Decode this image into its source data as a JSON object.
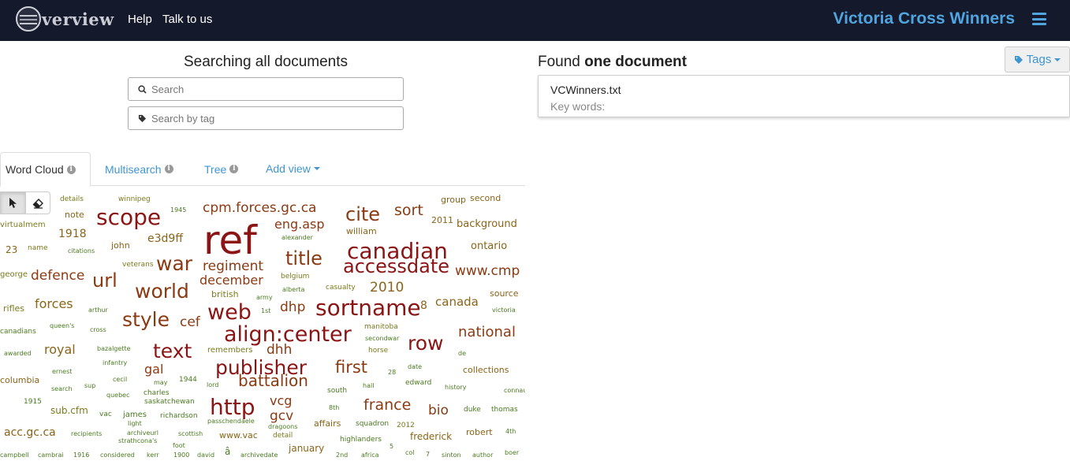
{
  "header": {
    "logo_text": "verview",
    "nav": [
      "Help",
      "Talk to us"
    ],
    "project_title": "Victoria Cross Winners",
    "colors": {
      "background": "#14192b",
      "accent": "#4fa5df"
    }
  },
  "search": {
    "title": "Searching all documents",
    "search_placeholder": "Search",
    "tag_placeholder": "Search by tag"
  },
  "tabs": [
    {
      "label": "Word Cloud",
      "active": true
    },
    {
      "label": "Multisearch",
      "active": false
    },
    {
      "label": "Tree",
      "active": false
    },
    {
      "label": "Add view",
      "active": false
    }
  ],
  "toolbar": {
    "icons": [
      "pointer-icon",
      "eraser-icon"
    ]
  },
  "word_cloud": [
    {
      "t": "ref",
      "s": 3,
      "c": "c0"
    },
    {
      "t": "scope",
      "s": 2,
      "c": "c0"
    },
    {
      "t": "canadian",
      "s": 2,
      "c": "c0"
    },
    {
      "t": "align:center",
      "s": 2,
      "c": "c0"
    },
    {
      "t": "accessdate",
      "s": 2,
      "c": "c0"
    },
    {
      "t": "sortname",
      "s": 2,
      "c": "c0"
    },
    {
      "t": "publisher",
      "s": 2,
      "c": "c0"
    },
    {
      "t": "web",
      "s": 2,
      "c": "c0"
    },
    {
      "t": "http",
      "s": 2,
      "c": "c0"
    },
    {
      "t": "text",
      "s": 2,
      "c": "c0"
    },
    {
      "t": "world",
      "s": 2,
      "c": "c1"
    },
    {
      "t": "style",
      "s": 2,
      "c": "c1"
    },
    {
      "t": "war",
      "s": 2,
      "c": "c1"
    },
    {
      "t": "title",
      "s": 2,
      "c": "c1"
    },
    {
      "t": "row",
      "s": 2,
      "c": "c0"
    },
    {
      "t": "cite",
      "s": 2,
      "c": "c1"
    },
    {
      "t": "url",
      "s": 2,
      "c": "c1"
    },
    {
      "t": "battalion",
      "s": 2,
      "c": "c1"
    },
    {
      "t": "first",
      "s": 2,
      "c": "c1"
    },
    {
      "t": "france",
      "s": 1,
      "c": "c1"
    },
    {
      "t": "national",
      "s": 1,
      "c": "c1"
    },
    {
      "t": "www.cmp",
      "s": 1,
      "c": "c1"
    },
    {
      "t": "sort",
      "s": 1,
      "c": "c1"
    },
    {
      "t": "cpm.forces.gc.ca",
      "s": 1,
      "c": "c1"
    },
    {
      "t": "eng.asp",
      "s": 1,
      "c": "c1"
    },
    {
      "t": "regiment",
      "s": 1,
      "c": "c1"
    },
    {
      "t": "december",
      "s": 1,
      "c": "c1"
    },
    {
      "t": "defence",
      "s": 1,
      "c": "c1"
    },
    {
      "t": "forces",
      "s": 1,
      "c": "c2"
    },
    {
      "t": "royal",
      "s": 1,
      "c": "c2"
    },
    {
      "t": "gal",
      "s": 1,
      "c": "c1"
    },
    {
      "t": "cef",
      "s": 1,
      "c": "c1"
    },
    {
      "t": "dhp",
      "s": 1,
      "c": "c1"
    },
    {
      "t": "dhh",
      "s": 1,
      "c": "c1"
    },
    {
      "t": "gcv",
      "s": 1,
      "c": "c1"
    },
    {
      "t": "vcg",
      "s": 1,
      "c": "c1"
    },
    {
      "t": "bio",
      "s": 1,
      "c": "c1"
    },
    {
      "t": "2010",
      "s": 1,
      "c": "c2"
    },
    {
      "t": "canada",
      "s": 1,
      "c": "c2"
    },
    {
      "t": "e3d9ff",
      "s": 1,
      "c": "c2"
    },
    {
      "t": "1918",
      "s": 1,
      "c": "c2"
    },
    {
      "t": "background",
      "s": 1,
      "c": "c2"
    },
    {
      "t": "ontario",
      "s": 1,
      "c": "c2"
    },
    {
      "t": "acc.gc.ca",
      "s": 1,
      "c": "c2"
    },
    {
      "t": "sub.cfm",
      "s": 1,
      "c": "c3"
    },
    {
      "t": "columbia",
      "s": 1,
      "c": "c2"
    },
    {
      "t": "collections",
      "s": 1,
      "c": "c2"
    },
    {
      "t": "frederick",
      "s": 1,
      "c": "c2"
    },
    {
      "t": "robert",
      "s": 1,
      "c": "c2"
    },
    {
      "t": "january",
      "s": 1,
      "c": "c2"
    },
    {
      "t": "www.vac",
      "s": 1,
      "c": "c2"
    },
    {
      "t": "affairs",
      "s": 1,
      "c": "c2"
    },
    {
      "t": "8",
      "s": 1,
      "c": "c2"
    },
    {
      "t": "23",
      "s": 1,
      "c": "c2"
    },
    {
      "t": "john",
      "s": 1,
      "c": "c2"
    },
    {
      "t": "william",
      "s": 1,
      "c": "c2"
    },
    {
      "t": "2011",
      "s": 1,
      "c": "c2"
    },
    {
      "t": "group",
      "s": 1,
      "c": "c2"
    },
    {
      "t": "second",
      "s": 1,
      "c": "c2"
    },
    {
      "t": "source",
      "s": 1,
      "c": "c2"
    },
    {
      "t": "note",
      "s": 1,
      "c": "c2"
    },
    {
      "t": "rifles",
      "s": 1,
      "c": "c3"
    },
    {
      "t": "details",
      "s": 1,
      "c": "c3"
    },
    {
      "t": "winnipeg",
      "s": 1,
      "c": "c3"
    },
    {
      "t": "1945",
      "s": 1,
      "c": "c4"
    },
    {
      "t": "virtualmem",
      "s": 1,
      "c": "c3"
    },
    {
      "t": "name",
      "s": 1,
      "c": "c3"
    },
    {
      "t": "citations",
      "s": 1,
      "c": "c4"
    },
    {
      "t": "veterans",
      "s": 1,
      "c": "c3"
    },
    {
      "t": "george",
      "s": 1,
      "c": "c3"
    },
    {
      "t": "alexander",
      "s": 1,
      "c": "c4"
    },
    {
      "t": "belgium",
      "s": 1,
      "c": "c3"
    },
    {
      "t": "casualty",
      "s": 1,
      "c": "c3"
    },
    {
      "t": "alberta",
      "s": 1,
      "c": "c4"
    },
    {
      "t": "army",
      "s": 1,
      "c": "c4"
    },
    {
      "t": "british",
      "s": 1,
      "c": "c3"
    },
    {
      "t": "1st",
      "s": 1,
      "c": "c4"
    },
    {
      "t": "arthur",
      "s": 1,
      "c": "c4"
    },
    {
      "t": "canadians",
      "s": 1,
      "c": "c4"
    },
    {
      "t": "queen's",
      "s": 1,
      "c": "c4"
    },
    {
      "t": "cross",
      "s": 1,
      "c": "c4"
    },
    {
      "t": "manitoba",
      "s": 1,
      "c": "c3"
    },
    {
      "t": "secondwar",
      "s": 1,
      "c": "c4"
    },
    {
      "t": "victoria",
      "s": 1,
      "c": "c4"
    },
    {
      "t": "horse",
      "s": 1,
      "c": "c3"
    },
    {
      "t": "de",
      "s": 1,
      "c": "c4"
    },
    {
      "t": "awarded",
      "s": 1,
      "c": "c4"
    },
    {
      "t": "bazalgette",
      "s": 1,
      "c": "c4"
    },
    {
      "t": "remembers",
      "s": 1,
      "c": "c3"
    },
    {
      "t": "infantry",
      "s": 1,
      "c": "c4"
    },
    {
      "t": "date",
      "s": 1,
      "c": "c4"
    },
    {
      "t": "ernest",
      "s": 1,
      "c": "c4"
    },
    {
      "t": "28",
      "s": 1,
      "c": "c4"
    },
    {
      "t": "cecil",
      "s": 1,
      "c": "c4"
    },
    {
      "t": "1944",
      "s": 1,
      "c": "c4"
    },
    {
      "t": "may",
      "s": 1,
      "c": "c4"
    },
    {
      "t": "lord",
      "s": 1,
      "c": "c4"
    },
    {
      "t": "hall",
      "s": 1,
      "c": "c4"
    },
    {
      "t": "edward",
      "s": 1,
      "c": "c4"
    },
    {
      "t": "history",
      "s": 1,
      "c": "c4"
    },
    {
      "t": "connaught's",
      "s": 1,
      "c": "c4"
    },
    {
      "t": "search",
      "s": 1,
      "c": "c4"
    },
    {
      "t": "sup",
      "s": 1,
      "c": "c4"
    },
    {
      "t": "charles",
      "s": 1,
      "c": "c4"
    },
    {
      "t": "south",
      "s": 1,
      "c": "c4"
    },
    {
      "t": "quebec",
      "s": 1,
      "c": "c4"
    },
    {
      "t": "saskatchewan",
      "s": 1,
      "c": "c4"
    },
    {
      "t": "1915",
      "s": 1,
      "c": "c4"
    },
    {
      "t": "8th",
      "s": 1,
      "c": "c4"
    },
    {
      "t": "duke",
      "s": 1,
      "c": "c4"
    },
    {
      "t": "thomas",
      "s": 1,
      "c": "c4"
    },
    {
      "t": "vac",
      "s": 1,
      "c": "c4"
    },
    {
      "t": "james",
      "s": 1,
      "c": "c4"
    },
    {
      "t": "richardson",
      "s": 1,
      "c": "c4"
    },
    {
      "t": "light",
      "s": 1,
      "c": "c4"
    },
    {
      "t": "detail",
      "s": 1,
      "c": "c3"
    },
    {
      "t": "2012",
      "s": 1,
      "c": "c3"
    },
    {
      "t": "4th",
      "s": 1,
      "c": "c4"
    },
    {
      "t": "recipients",
      "s": 1,
      "c": "c4"
    },
    {
      "t": "archiveurl",
      "s": 1,
      "c": "c4"
    },
    {
      "t": "scottish",
      "s": 1,
      "c": "c4"
    },
    {
      "t": "passchendaele",
      "s": 1,
      "c": "c4"
    },
    {
      "t": "dragoons",
      "s": 1,
      "c": "c4"
    },
    {
      "t": "squadron",
      "s": 1,
      "c": "c4"
    },
    {
      "t": "strathcona's",
      "s": 1,
      "c": "c4"
    },
    {
      "t": "foot",
      "s": 1,
      "c": "c4"
    },
    {
      "t": "highlanders",
      "s": 1,
      "c": "c4"
    },
    {
      "t": "5",
      "s": 1,
      "c": "c4"
    },
    {
      "t": "campbell",
      "s": 1,
      "c": "c4"
    },
    {
      "t": "cambrai",
      "s": 1,
      "c": "c4"
    },
    {
      "t": "1916",
      "s": 1,
      "c": "c4"
    },
    {
      "t": "considered",
      "s": 1,
      "c": "c4"
    },
    {
      "t": "kerr",
      "s": 1,
      "c": "c4"
    },
    {
      "t": "1900",
      "s": 1,
      "c": "c4"
    },
    {
      "t": "david",
      "s": 1,
      "c": "c4"
    },
    {
      "t": "â",
      "s": 1,
      "c": "c4"
    },
    {
      "t": "archivedate",
      "s": 1,
      "c": "c4"
    },
    {
      "t": "2nd",
      "s": 1,
      "c": "c4"
    },
    {
      "t": "africa",
      "s": 1,
      "c": "c4"
    },
    {
      "t": "col",
      "s": 1,
      "c": "c4"
    },
    {
      "t": "7",
      "s": 1,
      "c": "c4"
    },
    {
      "t": "sinton",
      "s": 1,
      "c": "c4"
    },
    {
      "t": "author",
      "s": 1,
      "c": "c4"
    },
    {
      "t": "boer",
      "s": 1,
      "c": "c4"
    }
  ],
  "cloud_colors": {
    "c0": "#8b1414",
    "c1": "#8b3a12",
    "c2": "#8a6418",
    "c3": "#7b7a1c",
    "c4": "#4a7a20"
  },
  "results": {
    "found_prefix": "Found ",
    "found_count": "one document",
    "tags_label": "Tags",
    "documents": [
      {
        "title": "VCWinners.txt",
        "keywords": "Key words:"
      }
    ]
  }
}
